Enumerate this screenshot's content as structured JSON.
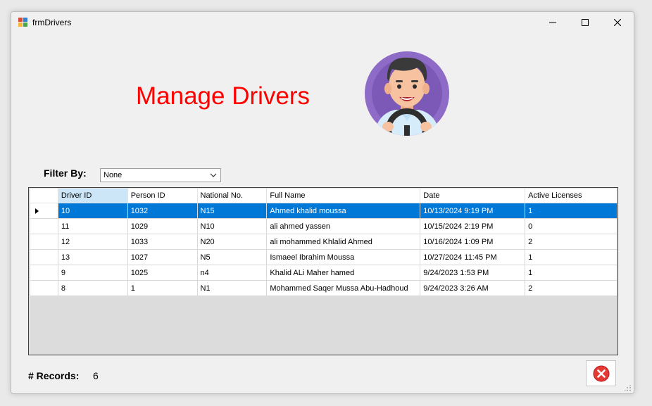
{
  "window": {
    "title": "frmDrivers"
  },
  "header": {
    "title": "Manage Drivers"
  },
  "filter": {
    "label": "Filter By:",
    "selected": "None"
  },
  "grid": {
    "columns": [
      "Driver ID",
      "Person ID",
      "National No.",
      "Full Name",
      "Date",
      "Active Licenses"
    ],
    "rows": [
      [
        "10",
        "1032",
        "N15",
        "Ahmed khalid  moussa",
        "10/13/2024 9:19 PM",
        "1"
      ],
      [
        "11",
        "1029",
        "N10",
        "ali ahmed  yassen",
        "10/15/2024 2:19 PM",
        "0"
      ],
      [
        "12",
        "1033",
        "N20",
        "ali mohammed Khlalid Ahmed",
        "10/16/2024 1:09 PM",
        "2"
      ],
      [
        "13",
        "1027",
        "N5",
        "Ismaeel Ibrahim  Moussa",
        "10/27/2024 11:45 PM",
        "1"
      ],
      [
        "9",
        "1025",
        "n4",
        "Khalid ALi Maher hamed",
        "9/24/2023 1:53 PM",
        "1"
      ],
      [
        "8",
        "1",
        "N1",
        "Mohammed Saqer Mussa Abu-Hadhoud",
        "9/24/2023 3:26 AM",
        "2"
      ]
    ]
  },
  "footer": {
    "records_label": "# Records:",
    "records_count": "6"
  },
  "colors": {
    "heading": "#ff0000",
    "selection": "#0078d7",
    "sorted_header": "#cde6f7",
    "close_icon": "#e53935"
  },
  "icons": [
    "app-icon",
    "minimize-icon",
    "maximize-icon",
    "close-icon",
    "driver-avatar",
    "chevron-down-icon",
    "close-circle-icon"
  ]
}
